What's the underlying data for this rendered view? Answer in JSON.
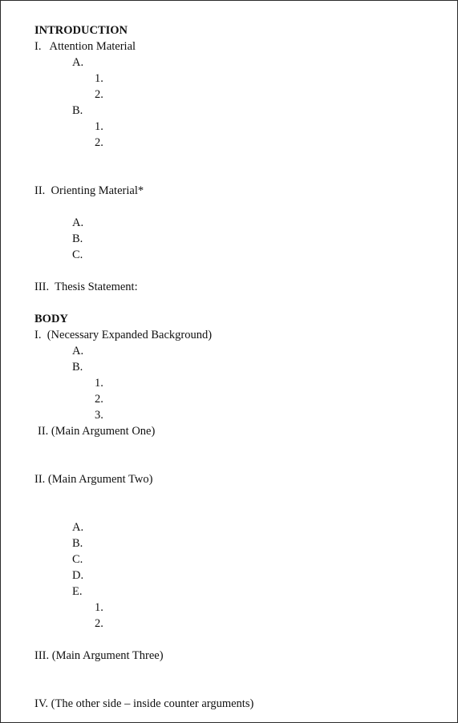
{
  "document": {
    "type": "speech-outline-template",
    "sections": [
      {
        "id": "introduction",
        "heading": "INTRODUCTION",
        "lines": [
          {
            "text": "I.   Attention Material",
            "level": "roman"
          },
          {
            "text": "A.",
            "level": "alpha"
          },
          {
            "text": "1.",
            "level": "num"
          },
          {
            "text": "2.",
            "level": "num"
          },
          {
            "text": "B.",
            "level": "alpha"
          },
          {
            "text": "1.",
            "level": "num"
          },
          {
            "text": "2.",
            "level": "num"
          },
          {
            "text": "",
            "level": "spacer"
          },
          {
            "text": "",
            "level": "spacer"
          },
          {
            "text": "II.  Orienting Material*",
            "level": "roman"
          },
          {
            "text": "",
            "level": "spacer"
          },
          {
            "text": "A.",
            "level": "alpha"
          },
          {
            "text": "B.",
            "level": "alpha"
          },
          {
            "text": "C.",
            "level": "alpha"
          },
          {
            "text": "",
            "level": "spacer"
          },
          {
            "text": "III.  Thesis Statement:",
            "level": "roman"
          },
          {
            "text": "",
            "level": "spacer"
          }
        ]
      },
      {
        "id": "body",
        "heading": "BODY",
        "lines": [
          {
            "text": "I.  (Necessary Expanded Background)",
            "level": "roman"
          },
          {
            "text": "A.",
            "level": "alpha"
          },
          {
            "text": "B.",
            "level": "alpha"
          },
          {
            "text": "1.",
            "level": "num"
          },
          {
            "text": "2.",
            "level": "num"
          },
          {
            "text": "3.",
            "level": "num"
          },
          {
            "text": "II. (Main Argument One)",
            "level": "roman-indent"
          },
          {
            "text": "",
            "level": "spacer"
          },
          {
            "text": "",
            "level": "spacer"
          },
          {
            "text": "II. (Main Argument Two)",
            "level": "roman"
          },
          {
            "text": "",
            "level": "spacer"
          },
          {
            "text": "",
            "level": "spacer"
          },
          {
            "text": "A.",
            "level": "alpha"
          },
          {
            "text": "B.",
            "level": "alpha"
          },
          {
            "text": "C.",
            "level": "alpha"
          },
          {
            "text": "D.",
            "level": "alpha"
          },
          {
            "text": "E.",
            "level": "alpha"
          },
          {
            "text": "1.",
            "level": "num"
          },
          {
            "text": "2.",
            "level": "num"
          },
          {
            "text": "",
            "level": "spacer"
          },
          {
            "text": "III. (Main Argument Three)",
            "level": "roman"
          },
          {
            "text": "",
            "level": "spacer"
          },
          {
            "text": "",
            "level": "spacer"
          },
          {
            "text": "IV. (The other side – inside counter arguments)",
            "level": "roman"
          }
        ]
      }
    ]
  },
  "style": {
    "text_color": "#101010",
    "page_background": "#ffffff",
    "border_color": "#2a2a2a"
  }
}
